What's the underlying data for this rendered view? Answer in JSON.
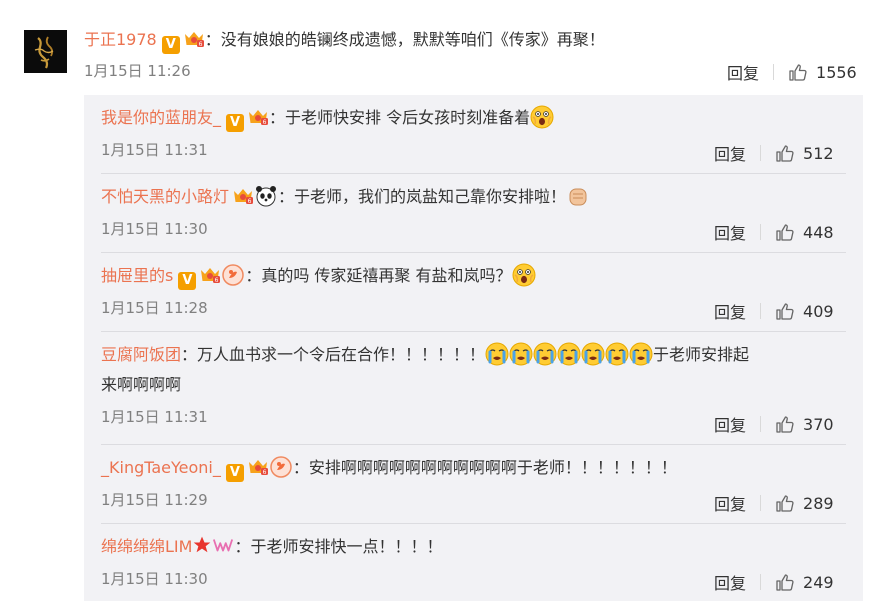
{
  "main_comment": {
    "username": "于正1978",
    "text": "：没有娘娘的皓镧终成遗憾，默默等咱们《传家》再聚！",
    "date": "1月15日 11:26",
    "reply_label": "回复",
    "likes": "1556"
  },
  "replies": [
    {
      "username": "我是你的蓝朋友_",
      "text": "：于老师快安排 令后女孩时刻准备着",
      "date": "1月15日 11:31",
      "reply_label": "回复",
      "likes": "512"
    },
    {
      "username": "不怕天黑的小路灯",
      "text": "：于老师，我们的岚盐知己靠你安排啦！",
      "date": "1月15日 11:30",
      "reply_label": "回复",
      "likes": "448"
    },
    {
      "username": "抽屉里的s",
      "text": "：真的吗 传家延禧再聚 有盐和岚吗？",
      "date": "1月15日 11:28",
      "reply_label": "回复",
      "likes": "409"
    },
    {
      "username": "豆腐阿饭团",
      "text": "：万人血书求一个令后在合作！！！！！！",
      "text_after": "于老师安排起",
      "text_line2": "来啊啊啊啊",
      "date": "1月15日 11:31",
      "reply_label": "回复",
      "likes": "370"
    },
    {
      "username": "_KingTaeYeoni_",
      "text": "：安排啊啊啊啊啊啊啊啊啊啊啊于老师！！！！！！！",
      "date": "1月15日 11:29",
      "reply_label": "回复",
      "likes": "289"
    },
    {
      "username": "绵绵绵绵LIM",
      "text": "：于老师安排快一点！！！！",
      "date": "1月15日 11:30",
      "reply_label": "回复",
      "likes": "249"
    }
  ],
  "icons": {
    "verified": "verified-v-badge-icon",
    "vip": "vip-crown-icon",
    "like": "thumbs-up-icon",
    "shocked": "shocked-face-emoji",
    "panda": "panda-emoji",
    "fist": "fist-emoji",
    "crying": "crying-face-emoji",
    "star": "red-star-icon",
    "w_badge": "w-badge-icon",
    "fruit": "fruit-badge-icon"
  },
  "colors": {
    "username": "#eb7350",
    "meta": "#808080",
    "panel_bg": "#f2f2f5",
    "text": "#333333"
  }
}
